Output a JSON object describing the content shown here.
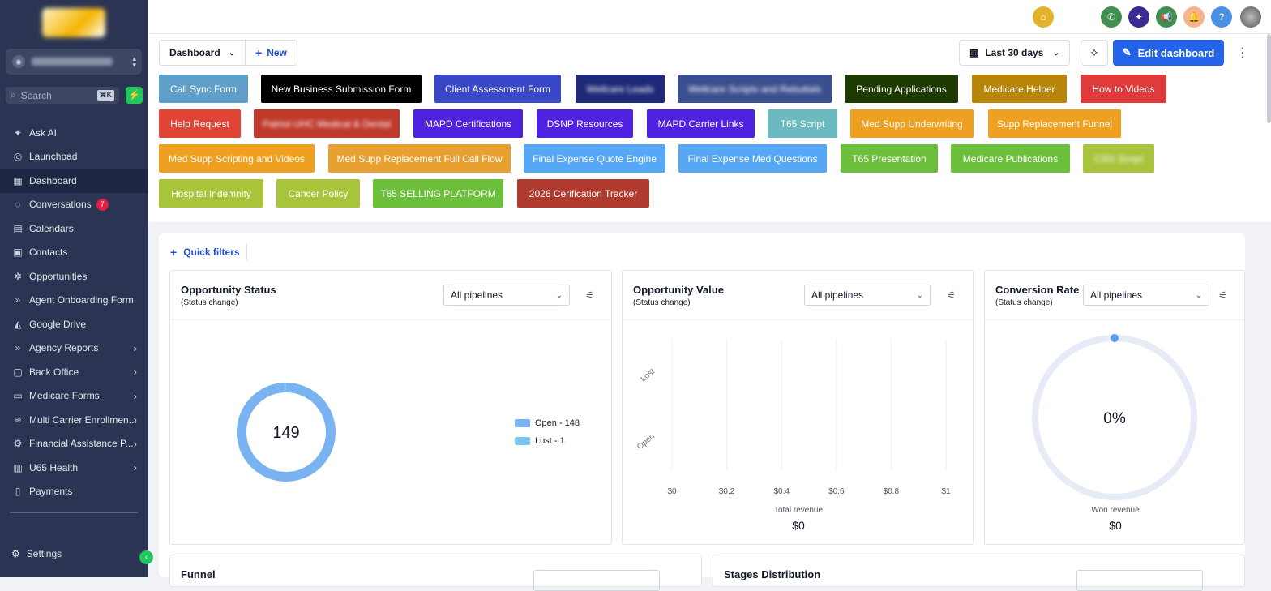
{
  "sidebar": {
    "search_placeholder": "Search",
    "search_shortcut": "⌘K",
    "items": [
      {
        "label": "Ask AI",
        "icon": "sparkle-icon"
      },
      {
        "label": "Launchpad",
        "icon": "rocket-icon"
      },
      {
        "label": "Dashboard",
        "icon": "grid-icon",
        "active": true
      },
      {
        "label": "Conversations",
        "icon": "chat-icon",
        "badge": "7"
      },
      {
        "label": "Calendars",
        "icon": "calendar-icon"
      },
      {
        "label": "Contacts",
        "icon": "contacts-icon"
      },
      {
        "label": "Opportunities",
        "icon": "opportunities-icon"
      },
      {
        "label": "Agent Onboarding Form",
        "icon": "double-chevron-icon"
      },
      {
        "label": "Google Drive",
        "icon": "drive-icon"
      },
      {
        "label": "Agency Reports",
        "icon": "double-chevron-icon",
        "expandable": true
      },
      {
        "label": "Back Office",
        "icon": "id-card-icon",
        "expandable": true
      },
      {
        "label": "Medicare Forms",
        "icon": "folder-icon",
        "expandable": true
      },
      {
        "label": "Multi Carrier Enrollmen...",
        "icon": "layers-icon",
        "expandable": true
      },
      {
        "label": "Financial Assistance P...",
        "icon": "gear-icon",
        "expandable": true
      },
      {
        "label": "U65 Health",
        "icon": "briefcase-icon",
        "expandable": true
      },
      {
        "label": "Payments",
        "icon": "receipt-icon"
      }
    ],
    "settings_label": "Settings"
  },
  "toolbar": {
    "dashboard_label": "Dashboard",
    "new_label": "New",
    "date_range": "Last 30 days",
    "edit_label": "Edit dashboard"
  },
  "chips": [
    {
      "label": "Call Sync Form",
      "color": "#5f9fc9"
    },
    {
      "label": "New Business Submission Form",
      "color": "#000000"
    },
    {
      "label": "Client Assessment Form",
      "color": "#3848c7"
    },
    {
      "label": "Wellcare Leads",
      "color": "#1e2a78",
      "blurred": true
    },
    {
      "label": "Wellcare Scripts and Rebuttals",
      "color": "#3b4f8f",
      "blurred": true
    },
    {
      "label": "Pending Applications",
      "color": "#1e3a00"
    },
    {
      "label": "Medicare Helper",
      "color": "#b8860b"
    },
    {
      "label": "How to Videos",
      "color": "#e03b3b"
    },
    {
      "label": "Help Request",
      "color": "#e04434"
    },
    {
      "label": "Patriot UHC Medical & Dental",
      "color": "#c0392b",
      "blurred": true
    },
    {
      "label": "MAPD Certifications",
      "color": "#4e22e0"
    },
    {
      "label": "DSNP Resources",
      "color": "#4e22e0"
    },
    {
      "label": "MAPD Carrier Links",
      "color": "#4e22e0"
    },
    {
      "label": "T65 Script",
      "color": "#6bbac2"
    },
    {
      "label": "Med Supp Underwriting",
      "color": "#f0a020"
    },
    {
      "label": "Supp Replacement Funnel",
      "color": "#f0a020"
    },
    {
      "label": "Med Supp Scripting and Videos",
      "color": "#f0a020"
    },
    {
      "label": "Med Supp Replacement Full Call Flow",
      "color": "#e8a030"
    },
    {
      "label": "Final Expense Quote Engine",
      "color": "#56a7f5"
    },
    {
      "label": "Final Expense Med Questions",
      "color": "#56a7f5"
    },
    {
      "label": "T65 Presentation",
      "color": "#6cbf3a"
    },
    {
      "label": "Medicare Publications",
      "color": "#6cbf3a"
    },
    {
      "label": "CSG Script",
      "color": "#a8c43a",
      "blurred": true
    },
    {
      "label": "Hospital Indemnity",
      "color": "#a8c43a"
    },
    {
      "label": "Cancer Policy",
      "color": "#a8c43a"
    },
    {
      "label": "T65 SELLING PLATFORM",
      "color": "#6cbf3a"
    },
    {
      "label": "2026 Cerification Tracker",
      "color": "#b03a2e"
    }
  ],
  "quick_filters": "Quick filters",
  "widgets": {
    "status": {
      "title": "Opportunity Status",
      "subtitle": "(Status change)",
      "pipeline": "All pipelines",
      "total": "149"
    },
    "value": {
      "title": "Opportunity Value",
      "subtitle": "(Status change)",
      "pipeline": "All pipelines",
      "caption": "Total revenue",
      "amount": "$0"
    },
    "conversion": {
      "title": "Conversion Rate",
      "subtitle": "(Status change)",
      "pipeline": "All pipelines",
      "percent": "0%",
      "caption": "Won revenue",
      "amount": "$0"
    }
  },
  "bottom": {
    "funnel_title": "Funnel",
    "stages_title": "Stages Distribution"
  },
  "chart_data": [
    {
      "type": "pie",
      "categories": [
        "Open",
        "Lost"
      ],
      "values": [
        148,
        1
      ],
      "legend": [
        "Open - 148",
        "Lost - 1"
      ],
      "colors": [
        "#7ab3f2",
        "#7cc5f0"
      ],
      "center_label": "149"
    },
    {
      "type": "bar",
      "categories": [
        "Lost",
        "Open"
      ],
      "values": [
        0,
        0
      ],
      "xticks": [
        "$0",
        "$0.2",
        "$0.4",
        "$0.6",
        "$0.8",
        "$1"
      ],
      "xlim": [
        0,
        1
      ],
      "xlabel": "Total revenue",
      "grid": true
    },
    {
      "type": "pie",
      "categories": [
        "Won"
      ],
      "values": [
        0
      ],
      "center_label": "0%"
    }
  ]
}
